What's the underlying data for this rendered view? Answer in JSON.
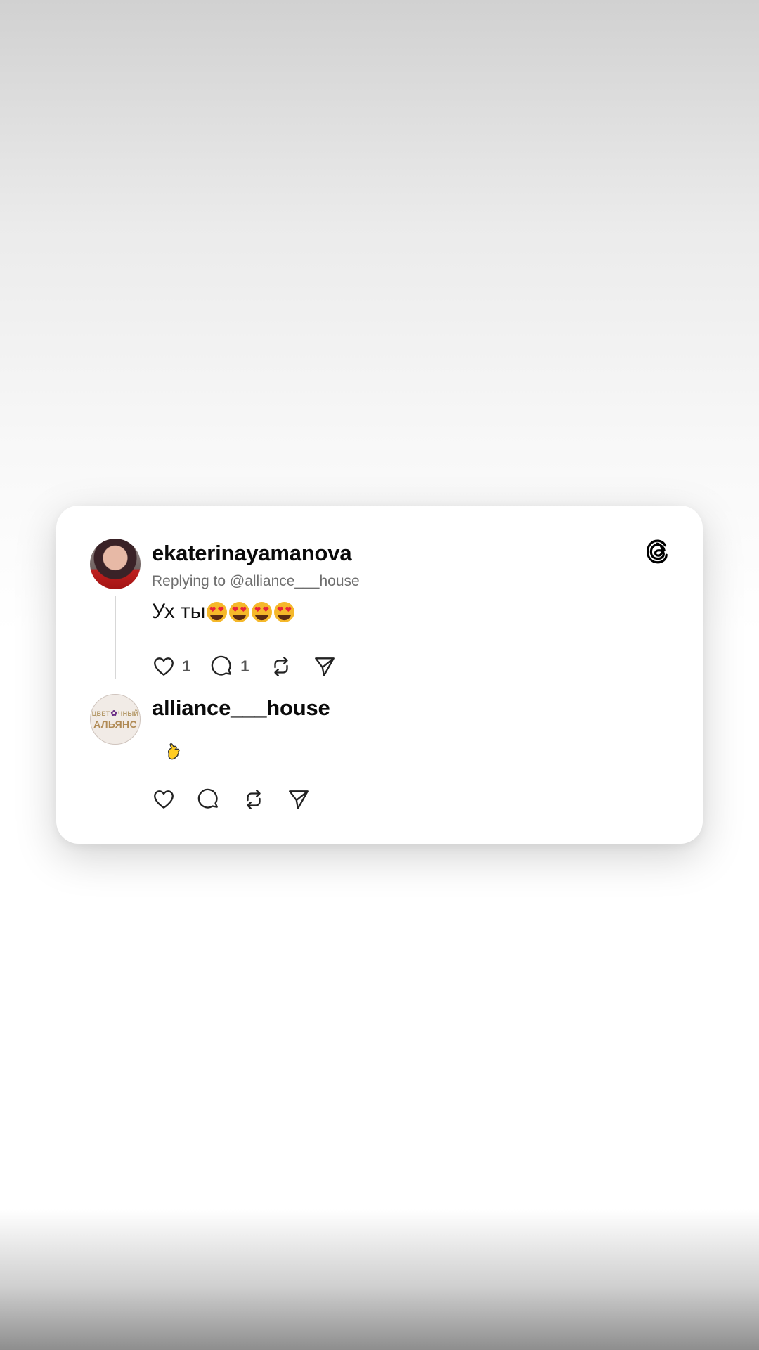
{
  "card": {
    "logo_icon": "threads-logo-icon",
    "reply": {
      "username": "ekaterinayamanova",
      "replying_to": "Replying to @alliance___house",
      "text": "Ух ты",
      "emoji": [
        "heart-eyes-emoji",
        "heart-eyes-emoji",
        "heart-eyes-emoji",
        "heart-eyes-emoji"
      ],
      "likes": "1",
      "comments": "1"
    },
    "comment": {
      "username": "alliance___house",
      "avatar_text_top": "ЦВЕТ",
      "avatar_text_top2": "ЧНЫЙ",
      "avatar_text_main": "АЛЬЯНС",
      "emoji": "hand-with-index-finger-and-thumb-crossed-emoji"
    }
  },
  "colors": {
    "card_bg": "#ffffff",
    "text_primary": "#0a0a0a",
    "text_secondary": "#6f6f6f",
    "thread_line": "#d7d7d7"
  }
}
